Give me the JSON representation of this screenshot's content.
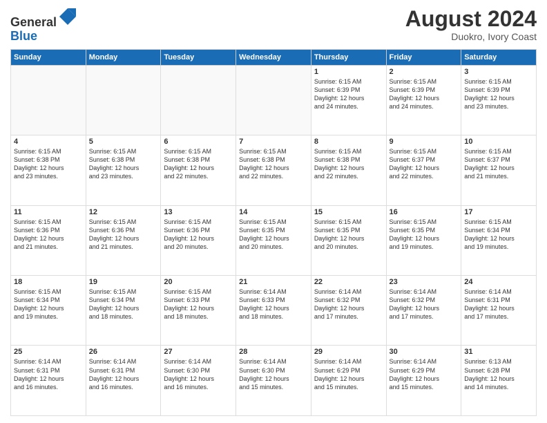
{
  "header": {
    "logo_line1": "General",
    "logo_line2": "Blue",
    "month_year": "August 2024",
    "location": "Duokro, Ivory Coast"
  },
  "days_of_week": [
    "Sunday",
    "Monday",
    "Tuesday",
    "Wednesday",
    "Thursday",
    "Friday",
    "Saturday"
  ],
  "weeks": [
    [
      {
        "day": "",
        "info": ""
      },
      {
        "day": "",
        "info": ""
      },
      {
        "day": "",
        "info": ""
      },
      {
        "day": "",
        "info": ""
      },
      {
        "day": "1",
        "info": "Sunrise: 6:15 AM\nSunset: 6:39 PM\nDaylight: 12 hours\nand 24 minutes."
      },
      {
        "day": "2",
        "info": "Sunrise: 6:15 AM\nSunset: 6:39 PM\nDaylight: 12 hours\nand 24 minutes."
      },
      {
        "day": "3",
        "info": "Sunrise: 6:15 AM\nSunset: 6:39 PM\nDaylight: 12 hours\nand 23 minutes."
      }
    ],
    [
      {
        "day": "4",
        "info": "Sunrise: 6:15 AM\nSunset: 6:38 PM\nDaylight: 12 hours\nand 23 minutes."
      },
      {
        "day": "5",
        "info": "Sunrise: 6:15 AM\nSunset: 6:38 PM\nDaylight: 12 hours\nand 23 minutes."
      },
      {
        "day": "6",
        "info": "Sunrise: 6:15 AM\nSunset: 6:38 PM\nDaylight: 12 hours\nand 22 minutes."
      },
      {
        "day": "7",
        "info": "Sunrise: 6:15 AM\nSunset: 6:38 PM\nDaylight: 12 hours\nand 22 minutes."
      },
      {
        "day": "8",
        "info": "Sunrise: 6:15 AM\nSunset: 6:38 PM\nDaylight: 12 hours\nand 22 minutes."
      },
      {
        "day": "9",
        "info": "Sunrise: 6:15 AM\nSunset: 6:37 PM\nDaylight: 12 hours\nand 22 minutes."
      },
      {
        "day": "10",
        "info": "Sunrise: 6:15 AM\nSunset: 6:37 PM\nDaylight: 12 hours\nand 21 minutes."
      }
    ],
    [
      {
        "day": "11",
        "info": "Sunrise: 6:15 AM\nSunset: 6:36 PM\nDaylight: 12 hours\nand 21 minutes."
      },
      {
        "day": "12",
        "info": "Sunrise: 6:15 AM\nSunset: 6:36 PM\nDaylight: 12 hours\nand 21 minutes."
      },
      {
        "day": "13",
        "info": "Sunrise: 6:15 AM\nSunset: 6:36 PM\nDaylight: 12 hours\nand 20 minutes."
      },
      {
        "day": "14",
        "info": "Sunrise: 6:15 AM\nSunset: 6:35 PM\nDaylight: 12 hours\nand 20 minutes."
      },
      {
        "day": "15",
        "info": "Sunrise: 6:15 AM\nSunset: 6:35 PM\nDaylight: 12 hours\nand 20 minutes."
      },
      {
        "day": "16",
        "info": "Sunrise: 6:15 AM\nSunset: 6:35 PM\nDaylight: 12 hours\nand 19 minutes."
      },
      {
        "day": "17",
        "info": "Sunrise: 6:15 AM\nSunset: 6:34 PM\nDaylight: 12 hours\nand 19 minutes."
      }
    ],
    [
      {
        "day": "18",
        "info": "Sunrise: 6:15 AM\nSunset: 6:34 PM\nDaylight: 12 hours\nand 19 minutes."
      },
      {
        "day": "19",
        "info": "Sunrise: 6:15 AM\nSunset: 6:34 PM\nDaylight: 12 hours\nand 18 minutes."
      },
      {
        "day": "20",
        "info": "Sunrise: 6:15 AM\nSunset: 6:33 PM\nDaylight: 12 hours\nand 18 minutes."
      },
      {
        "day": "21",
        "info": "Sunrise: 6:14 AM\nSunset: 6:33 PM\nDaylight: 12 hours\nand 18 minutes."
      },
      {
        "day": "22",
        "info": "Sunrise: 6:14 AM\nSunset: 6:32 PM\nDaylight: 12 hours\nand 17 minutes."
      },
      {
        "day": "23",
        "info": "Sunrise: 6:14 AM\nSunset: 6:32 PM\nDaylight: 12 hours\nand 17 minutes."
      },
      {
        "day": "24",
        "info": "Sunrise: 6:14 AM\nSunset: 6:31 PM\nDaylight: 12 hours\nand 17 minutes."
      }
    ],
    [
      {
        "day": "25",
        "info": "Sunrise: 6:14 AM\nSunset: 6:31 PM\nDaylight: 12 hours\nand 16 minutes."
      },
      {
        "day": "26",
        "info": "Sunrise: 6:14 AM\nSunset: 6:31 PM\nDaylight: 12 hours\nand 16 minutes."
      },
      {
        "day": "27",
        "info": "Sunrise: 6:14 AM\nSunset: 6:30 PM\nDaylight: 12 hours\nand 16 minutes."
      },
      {
        "day": "28",
        "info": "Sunrise: 6:14 AM\nSunset: 6:30 PM\nDaylight: 12 hours\nand 15 minutes."
      },
      {
        "day": "29",
        "info": "Sunrise: 6:14 AM\nSunset: 6:29 PM\nDaylight: 12 hours\nand 15 minutes."
      },
      {
        "day": "30",
        "info": "Sunrise: 6:14 AM\nSunset: 6:29 PM\nDaylight: 12 hours\nand 15 minutes."
      },
      {
        "day": "31",
        "info": "Sunrise: 6:13 AM\nSunset: 6:28 PM\nDaylight: 12 hours\nand 14 minutes."
      }
    ]
  ]
}
